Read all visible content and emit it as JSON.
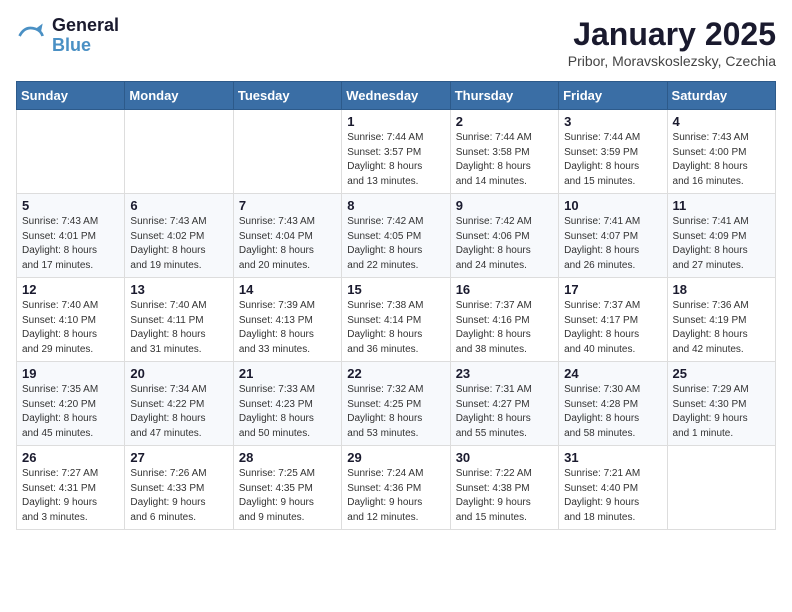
{
  "header": {
    "logo_line1": "General",
    "logo_line2": "Blue",
    "month_year": "January 2025",
    "location": "Pribor, Moravskoslezsky, Czechia"
  },
  "weekdays": [
    "Sunday",
    "Monday",
    "Tuesday",
    "Wednesday",
    "Thursday",
    "Friday",
    "Saturday"
  ],
  "weeks": [
    [
      {
        "day": "",
        "info": ""
      },
      {
        "day": "",
        "info": ""
      },
      {
        "day": "",
        "info": ""
      },
      {
        "day": "1",
        "info": "Sunrise: 7:44 AM\nSunset: 3:57 PM\nDaylight: 8 hours\nand 13 minutes."
      },
      {
        "day": "2",
        "info": "Sunrise: 7:44 AM\nSunset: 3:58 PM\nDaylight: 8 hours\nand 14 minutes."
      },
      {
        "day": "3",
        "info": "Sunrise: 7:44 AM\nSunset: 3:59 PM\nDaylight: 8 hours\nand 15 minutes."
      },
      {
        "day": "4",
        "info": "Sunrise: 7:43 AM\nSunset: 4:00 PM\nDaylight: 8 hours\nand 16 minutes."
      }
    ],
    [
      {
        "day": "5",
        "info": "Sunrise: 7:43 AM\nSunset: 4:01 PM\nDaylight: 8 hours\nand 17 minutes."
      },
      {
        "day": "6",
        "info": "Sunrise: 7:43 AM\nSunset: 4:02 PM\nDaylight: 8 hours\nand 19 minutes."
      },
      {
        "day": "7",
        "info": "Sunrise: 7:43 AM\nSunset: 4:04 PM\nDaylight: 8 hours\nand 20 minutes."
      },
      {
        "day": "8",
        "info": "Sunrise: 7:42 AM\nSunset: 4:05 PM\nDaylight: 8 hours\nand 22 minutes."
      },
      {
        "day": "9",
        "info": "Sunrise: 7:42 AM\nSunset: 4:06 PM\nDaylight: 8 hours\nand 24 minutes."
      },
      {
        "day": "10",
        "info": "Sunrise: 7:41 AM\nSunset: 4:07 PM\nDaylight: 8 hours\nand 26 minutes."
      },
      {
        "day": "11",
        "info": "Sunrise: 7:41 AM\nSunset: 4:09 PM\nDaylight: 8 hours\nand 27 minutes."
      }
    ],
    [
      {
        "day": "12",
        "info": "Sunrise: 7:40 AM\nSunset: 4:10 PM\nDaylight: 8 hours\nand 29 minutes."
      },
      {
        "day": "13",
        "info": "Sunrise: 7:40 AM\nSunset: 4:11 PM\nDaylight: 8 hours\nand 31 minutes."
      },
      {
        "day": "14",
        "info": "Sunrise: 7:39 AM\nSunset: 4:13 PM\nDaylight: 8 hours\nand 33 minutes."
      },
      {
        "day": "15",
        "info": "Sunrise: 7:38 AM\nSunset: 4:14 PM\nDaylight: 8 hours\nand 36 minutes."
      },
      {
        "day": "16",
        "info": "Sunrise: 7:37 AM\nSunset: 4:16 PM\nDaylight: 8 hours\nand 38 minutes."
      },
      {
        "day": "17",
        "info": "Sunrise: 7:37 AM\nSunset: 4:17 PM\nDaylight: 8 hours\nand 40 minutes."
      },
      {
        "day": "18",
        "info": "Sunrise: 7:36 AM\nSunset: 4:19 PM\nDaylight: 8 hours\nand 42 minutes."
      }
    ],
    [
      {
        "day": "19",
        "info": "Sunrise: 7:35 AM\nSunset: 4:20 PM\nDaylight: 8 hours\nand 45 minutes."
      },
      {
        "day": "20",
        "info": "Sunrise: 7:34 AM\nSunset: 4:22 PM\nDaylight: 8 hours\nand 47 minutes."
      },
      {
        "day": "21",
        "info": "Sunrise: 7:33 AM\nSunset: 4:23 PM\nDaylight: 8 hours\nand 50 minutes."
      },
      {
        "day": "22",
        "info": "Sunrise: 7:32 AM\nSunset: 4:25 PM\nDaylight: 8 hours\nand 53 minutes."
      },
      {
        "day": "23",
        "info": "Sunrise: 7:31 AM\nSunset: 4:27 PM\nDaylight: 8 hours\nand 55 minutes."
      },
      {
        "day": "24",
        "info": "Sunrise: 7:30 AM\nSunset: 4:28 PM\nDaylight: 8 hours\nand 58 minutes."
      },
      {
        "day": "25",
        "info": "Sunrise: 7:29 AM\nSunset: 4:30 PM\nDaylight: 9 hours\nand 1 minute."
      }
    ],
    [
      {
        "day": "26",
        "info": "Sunrise: 7:27 AM\nSunset: 4:31 PM\nDaylight: 9 hours\nand 3 minutes."
      },
      {
        "day": "27",
        "info": "Sunrise: 7:26 AM\nSunset: 4:33 PM\nDaylight: 9 hours\nand 6 minutes."
      },
      {
        "day": "28",
        "info": "Sunrise: 7:25 AM\nSunset: 4:35 PM\nDaylight: 9 hours\nand 9 minutes."
      },
      {
        "day": "29",
        "info": "Sunrise: 7:24 AM\nSunset: 4:36 PM\nDaylight: 9 hours\nand 12 minutes."
      },
      {
        "day": "30",
        "info": "Sunrise: 7:22 AM\nSunset: 4:38 PM\nDaylight: 9 hours\nand 15 minutes."
      },
      {
        "day": "31",
        "info": "Sunrise: 7:21 AM\nSunset: 4:40 PM\nDaylight: 9 hours\nand 18 minutes."
      },
      {
        "day": "",
        "info": ""
      }
    ]
  ]
}
